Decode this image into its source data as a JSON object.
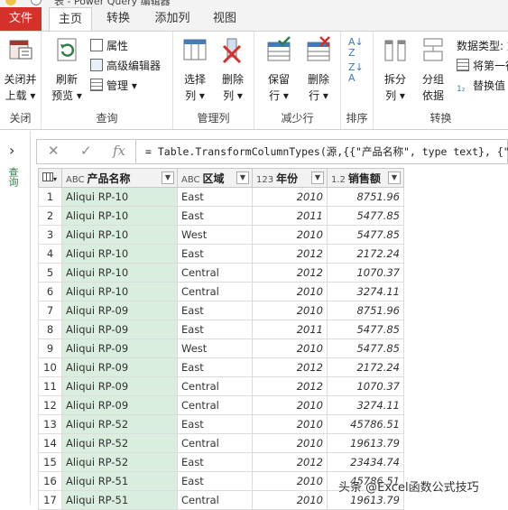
{
  "window": {
    "title": "表 - Power Query 编辑器"
  },
  "tabs": [
    {
      "label": "文件"
    },
    {
      "label": "主页"
    },
    {
      "label": "转换"
    },
    {
      "label": "添加列"
    },
    {
      "label": "视图"
    }
  ],
  "ribbon": {
    "close": {
      "button": "关闭并\n上载",
      "button_l1": "关闭并",
      "button_l2": "上载",
      "group": "关闭"
    },
    "query": {
      "refresh_l1": "刷新",
      "refresh_l2": "预览",
      "properties": "属性",
      "advanced_editor": "高级编辑器",
      "manage": "管理",
      "group": "查询"
    },
    "manage_columns": {
      "choose_l1": "选择",
      "choose_l2": "列",
      "remove_l1": "删除",
      "remove_l2": "列",
      "group": "管理列"
    },
    "reduce_rows": {
      "keep_l1": "保留",
      "keep_l2": "行",
      "remove_l1": "删除",
      "remove_l2": "行",
      "group": "减少行"
    },
    "sort": {
      "group": "排序"
    },
    "transform": {
      "split_l1": "拆分",
      "split_l2": "列",
      "groupby_l1": "分组",
      "groupby_l2": "依据",
      "datatype": "数据类型: 文",
      "first_row": "将第一行",
      "replace": "替换值",
      "group": "转换"
    }
  },
  "nav": {
    "queries_label": "查询"
  },
  "formula": {
    "text": "= Table.TransformColumnTypes(源,{{\"产品名称\", type text}, {\"区"
  },
  "columns": [
    {
      "type_icon": "ABC",
      "name": "产品名称"
    },
    {
      "type_icon": "ABC",
      "name": "区域"
    },
    {
      "type_icon": "123",
      "name": "年份"
    },
    {
      "type_icon": "1.2",
      "name": "销售额"
    }
  ],
  "rows": [
    {
      "n": "1",
      "product": "Aliqui RP-10",
      "region": "East",
      "year": "2010",
      "sales": "8751.96"
    },
    {
      "n": "2",
      "product": "Aliqui RP-10",
      "region": "East",
      "year": "2011",
      "sales": "5477.85"
    },
    {
      "n": "3",
      "product": "Aliqui RP-10",
      "region": "West",
      "year": "2010",
      "sales": "5477.85"
    },
    {
      "n": "4",
      "product": "Aliqui RP-10",
      "region": "East",
      "year": "2012",
      "sales": "2172.24"
    },
    {
      "n": "5",
      "product": "Aliqui RP-10",
      "region": "Central",
      "year": "2012",
      "sales": "1070.37"
    },
    {
      "n": "6",
      "product": "Aliqui RP-10",
      "region": "Central",
      "year": "2010",
      "sales": "3274.11"
    },
    {
      "n": "7",
      "product": "Aliqui RP-09",
      "region": "East",
      "year": "2010",
      "sales": "8751.96"
    },
    {
      "n": "8",
      "product": "Aliqui RP-09",
      "region": "East",
      "year": "2011",
      "sales": "5477.85"
    },
    {
      "n": "9",
      "product": "Aliqui RP-09",
      "region": "West",
      "year": "2010",
      "sales": "5477.85"
    },
    {
      "n": "10",
      "product": "Aliqui RP-09",
      "region": "East",
      "year": "2012",
      "sales": "2172.24"
    },
    {
      "n": "11",
      "product": "Aliqui RP-09",
      "region": "Central",
      "year": "2012",
      "sales": "1070.37"
    },
    {
      "n": "12",
      "product": "Aliqui RP-09",
      "region": "Central",
      "year": "2010",
      "sales": "3274.11"
    },
    {
      "n": "13",
      "product": "Aliqui RP-52",
      "region": "East",
      "year": "2010",
      "sales": "45786.51"
    },
    {
      "n": "14",
      "product": "Aliqui RP-52",
      "region": "Central",
      "year": "2010",
      "sales": "19613.79"
    },
    {
      "n": "15",
      "product": "Aliqui RP-52",
      "region": "East",
      "year": "2012",
      "sales": "23434.74"
    },
    {
      "n": "16",
      "product": "Aliqui RP-51",
      "region": "East",
      "year": "2010",
      "sales": "45786.51"
    },
    {
      "n": "17",
      "product": "Aliqui RP-51",
      "region": "Central",
      "year": "2010",
      "sales": "19613.79"
    }
  ],
  "watermark": "头条 @Excel函数公式技巧",
  "colors": {
    "file_tab": "#d6302a",
    "product_column": "#d9eedf",
    "accent_green": "#2f7d4b"
  }
}
